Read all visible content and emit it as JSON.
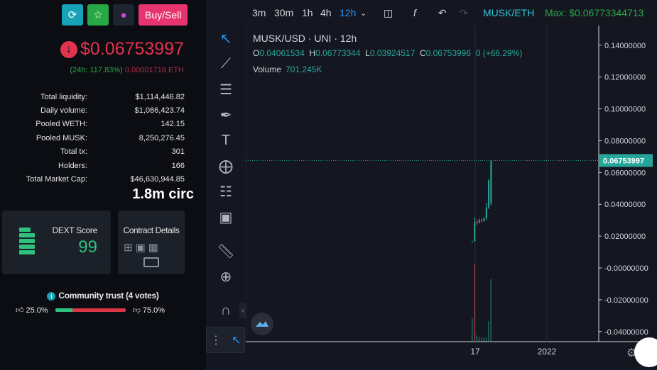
{
  "header": {
    "buy_sell_label": "Buy/Sell",
    "icons": [
      "share-icon",
      "star-icon",
      "v-logo-icon"
    ]
  },
  "price": {
    "value": "$0.06753997",
    "change_24h": "(24h: 117.83%)",
    "eth_value": "0.00001718 ETH",
    "colors": {
      "down": "#e0334f",
      "up": "#28a745"
    }
  },
  "stats": [
    {
      "label": "Total liquidity:",
      "value": "$1,114,446.82"
    },
    {
      "label": "Daily volume:",
      "value": "$1,086,423.74"
    },
    {
      "label": "Pooled WETH:",
      "value": "142.15"
    },
    {
      "label": "Pooled MUSK:",
      "value": "8,250,276.45"
    },
    {
      "label": "Total tx:",
      "value": "301"
    },
    {
      "label": "Holders:",
      "value": "166"
    },
    {
      "label": "Total Market Cap:",
      "value": "$46,630,944.85"
    }
  ],
  "circ_label": "1.8m circ",
  "dext": {
    "title": "DEXT Score",
    "score": "99"
  },
  "contract": {
    "title": "Contract Details"
  },
  "trust": {
    "title": "Community trust (4 votes)",
    "up_pct": "25.0%",
    "down_pct": "75.0%",
    "up_fraction": 0.25
  },
  "toolbar": {
    "timeframes": [
      "3m",
      "30m",
      "1h",
      "4h",
      "12h"
    ],
    "active_timeframe": "12h",
    "pair_label": "MUSK/ETH",
    "max_label": "Max: $0.06773344713"
  },
  "chart_legend": {
    "title": "MUSK/USD · UNI · 12h",
    "o_label": "O",
    "o": "0.04061534",
    "h_label": "H",
    "h": "0.06773344",
    "l_label": "L",
    "l": "0.03924517",
    "c_label": "C",
    "c": "0.06753996",
    "change": "0 (+66.29%)",
    "volume_label": "Volume",
    "volume": "701.245K"
  },
  "chart_data": {
    "type": "candlestick",
    "ylim": [
      -0.045,
      0.16
    ],
    "y_ticks": [
      "0.14000000",
      "0.12000000",
      "0.10000000",
      "0.08000000",
      "0.06000000",
      "0.04000000",
      "0.02000000",
      "-0.00000000",
      "-0.02000000",
      "-0.04000000"
    ],
    "y_tick_values": [
      0.14,
      0.12,
      0.1,
      0.08,
      0.06,
      0.04,
      0.02,
      0,
      -0.02,
      -0.04
    ],
    "x_ticks": [
      "17",
      "2022"
    ],
    "current_price_label": "0.06753997",
    "current_price": 0.06753997,
    "candles": [
      {
        "o": 0.0165,
        "h": 0.017,
        "l": 0.0163,
        "c": 0.0168
      },
      {
        "o": 0.0168,
        "h": 0.032,
        "l": 0.0165,
        "c": 0.029
      },
      {
        "o": 0.029,
        "h": 0.0305,
        "l": 0.027,
        "c": 0.0285
      },
      {
        "o": 0.0285,
        "h": 0.031,
        "l": 0.028,
        "c": 0.03
      },
      {
        "o": 0.03,
        "h": 0.031,
        "l": 0.0285,
        "c": 0.0295
      },
      {
        "o": 0.0295,
        "h": 0.032,
        "l": 0.029,
        "c": 0.031
      },
      {
        "o": 0.031,
        "h": 0.041,
        "l": 0.03,
        "c": 0.038
      },
      {
        "o": 0.038,
        "h": 0.056,
        "l": 0.037,
        "c": 0.055
      },
      {
        "o": 0.0406,
        "h": 0.0677,
        "l": 0.0392,
        "c": 0.0675
      }
    ],
    "volumes": [
      0.3,
      1.0,
      0.08,
      0.06,
      0.05,
      0.05,
      0.05,
      0.26,
      0.8
    ],
    "colors": {
      "up": "#26a69a",
      "down": "#ef5350",
      "accent": "#2196f3"
    }
  }
}
